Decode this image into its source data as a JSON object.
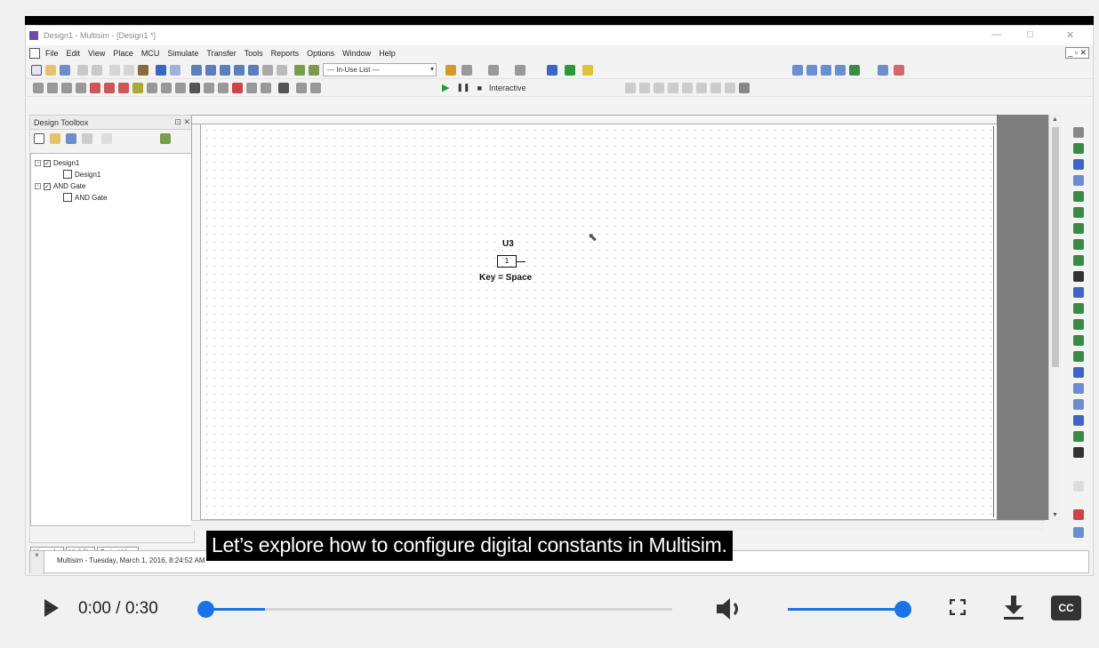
{
  "window": {
    "title": "Design1 - Multisim - [Design1 *]",
    "controls": {
      "minimize": "—",
      "restore": "□",
      "close": "✕"
    }
  },
  "menubar": {
    "items": [
      "File",
      "Edit",
      "View",
      "Place",
      "MCU",
      "Simulate",
      "Transfer",
      "Tools",
      "Reports",
      "Options",
      "Window",
      "Help"
    ],
    "mdi_controls": "_ ▫ ✕"
  },
  "toolbar": {
    "in_use_list": "--- In-Use List ---",
    "interactive_label": "Interactive"
  },
  "design_toolbox": {
    "title": "Design Toolbox",
    "pin": "⊡ ✕",
    "tree": [
      {
        "label": "Design1",
        "level": 0
      },
      {
        "label": "Design1",
        "level": 1
      },
      {
        "label": "AND Gate",
        "level": 0
      },
      {
        "label": "AND Gate",
        "level": 1
      }
    ],
    "tabs": [
      "Hierarchy",
      "Visibility",
      "Project View"
    ]
  },
  "schematic": {
    "component_ref": "U3",
    "component_value": "1",
    "component_key_label": "Key = Space"
  },
  "status": {
    "message": "Multisim  -  Tuesday, March 1, 2016, 8:24:52 AM"
  },
  "caption": "Let’s explore how to configure digital constants in Multisim.",
  "video": {
    "time": "0:00 / 0:30",
    "progress": 0.13,
    "volume": 1.0,
    "cc_label": "CC"
  }
}
